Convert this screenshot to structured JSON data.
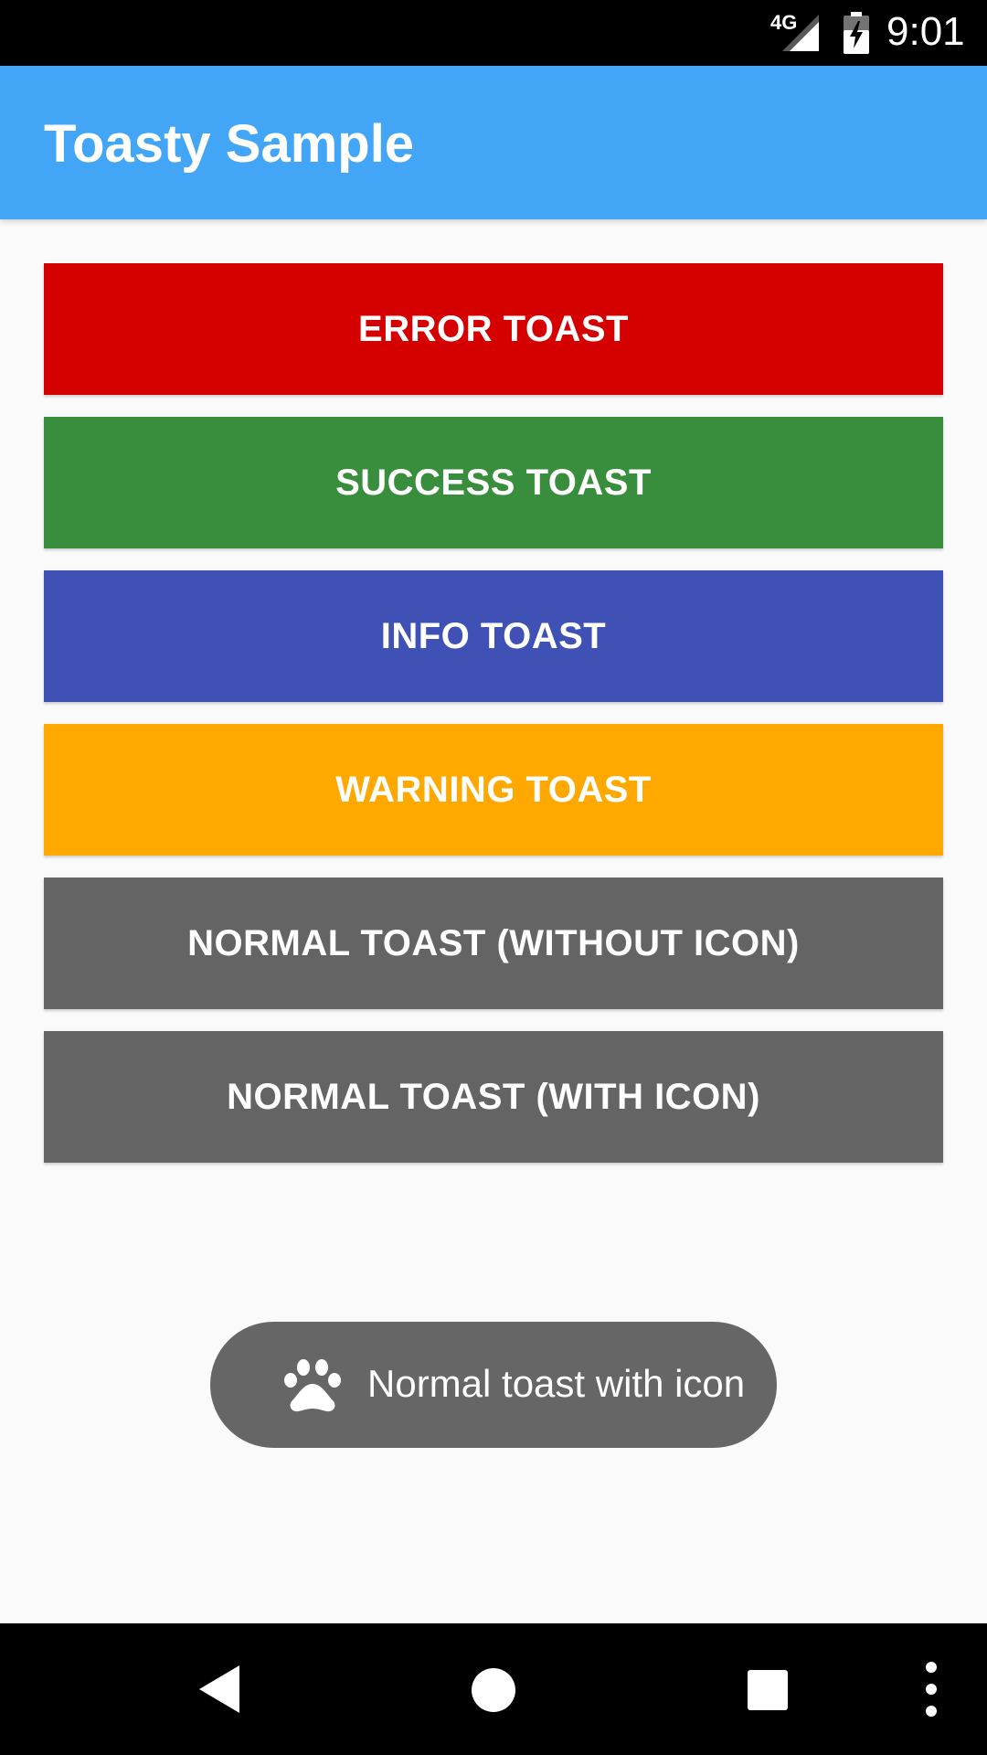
{
  "status_bar": {
    "network_label": "4G",
    "time": "9:01",
    "icons": [
      "signal-icon",
      "battery-charging-icon"
    ]
  },
  "app_bar": {
    "title": "Toasty Sample",
    "color": "#42a5f5"
  },
  "buttons": [
    {
      "label": "ERROR TOAST",
      "color": "#d50000"
    },
    {
      "label": "SUCCESS TOAST",
      "color": "#388e3c"
    },
    {
      "label": "INFO TOAST",
      "color": "#3f51b5"
    },
    {
      "label": "WARNING TOAST",
      "color": "#ffa900"
    },
    {
      "label": "NORMAL TOAST (WITHOUT ICON)",
      "color": "#646464"
    },
    {
      "label": "NORMAL TOAST (WITH ICON)",
      "color": "#646464"
    }
  ],
  "toast": {
    "text": "Normal toast with icon",
    "icon": "paw-icon",
    "color": "#666666"
  },
  "nav_bar": {
    "icons": [
      "back-icon",
      "home-icon",
      "recents-icon",
      "more-vert-icon"
    ]
  }
}
